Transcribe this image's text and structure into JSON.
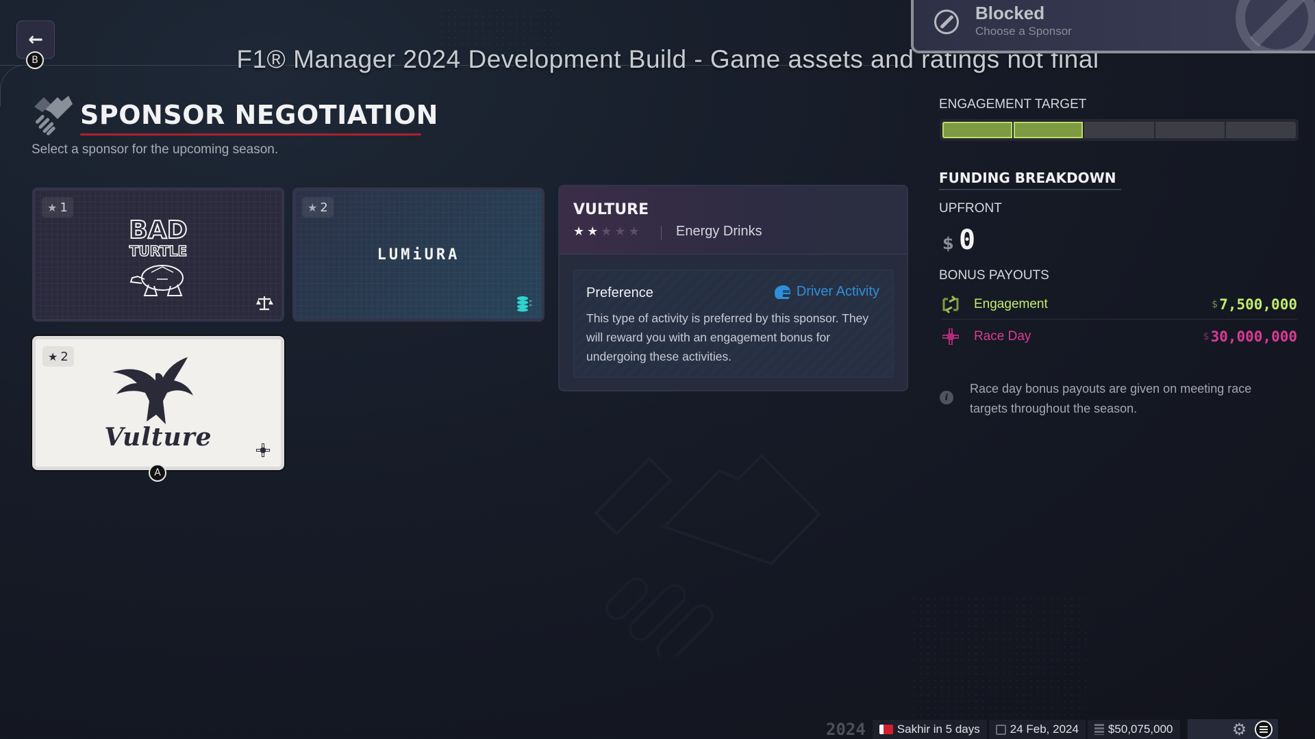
{
  "window": {
    "dev_banner": "F1® Manager 2024 Development Build - Game assets and ratings not final"
  },
  "nav": {
    "back_icon": "arrow-left-icon",
    "back_hint": "B"
  },
  "toast": {
    "icon": "blocked-icon",
    "title": "Blocked",
    "subtitle": "Choose a Sponsor"
  },
  "header": {
    "icon": "handshake-icon",
    "title": "SPONSOR NEGOTIATION",
    "subtitle": "Select a sponsor for the upcoming season."
  },
  "sponsors": [
    {
      "name": "Bad Turtle",
      "logo_text": "BAD TURTLE",
      "tier": "1",
      "type_icon": "scales-icon",
      "selected": false
    },
    {
      "name": "Lumiura",
      "logo_text": "LUMiURA",
      "tier": "2",
      "type_icon": "coins-stack-icon",
      "selected": false
    },
    {
      "name": "Vulture",
      "logo_text": "Vulture",
      "tier": "2",
      "type_icon": "race-day-icon",
      "selected": true
    }
  ],
  "select_hint": "A",
  "detail": {
    "name": "VULTURE",
    "rating": 2,
    "rating_max": 5,
    "category": "Energy Drinks",
    "preference_label": "Preference",
    "preference_icon": "helmet-icon",
    "preference_value": "Driver Activity",
    "preference_desc": "This type of activity is preferred by this sponsor. They will reward you with an engagement bonus for undergoing these activities."
  },
  "engagement": {
    "label": "ENGAGEMENT TARGET",
    "filled_segments": 2,
    "total_segments": 5
  },
  "funding": {
    "title": "FUNDING BREAKDOWN",
    "upfront_label": "UPFRONT",
    "currency": "$",
    "upfront_value": "0",
    "bonus_label": "BONUS PAYOUTS",
    "bonuses": [
      {
        "icon": "engagement-cycle-icon",
        "label": "Engagement",
        "currency": "$",
        "amount": "7,500,000",
        "color": "#c3ec6c"
      },
      {
        "icon": "race-day-icon",
        "label": "Race Day",
        "currency": "$",
        "amount": "30,000,000",
        "color": "#db3a94"
      }
    ],
    "info_icon": "info-icon",
    "info_text": "Race day bonus payouts are given on meeting race targets throughout the season."
  },
  "status_bar": {
    "year": "2024",
    "next_race": "Sakhir in 5 days",
    "date": "24 Feb, 2024",
    "balance": "$50,075,000"
  },
  "colors": {
    "accent_red": "#b0202a",
    "engagement_green": "#c3ec6c",
    "race_day_pink": "#db3a94",
    "preference_blue": "#2f8fd8"
  }
}
